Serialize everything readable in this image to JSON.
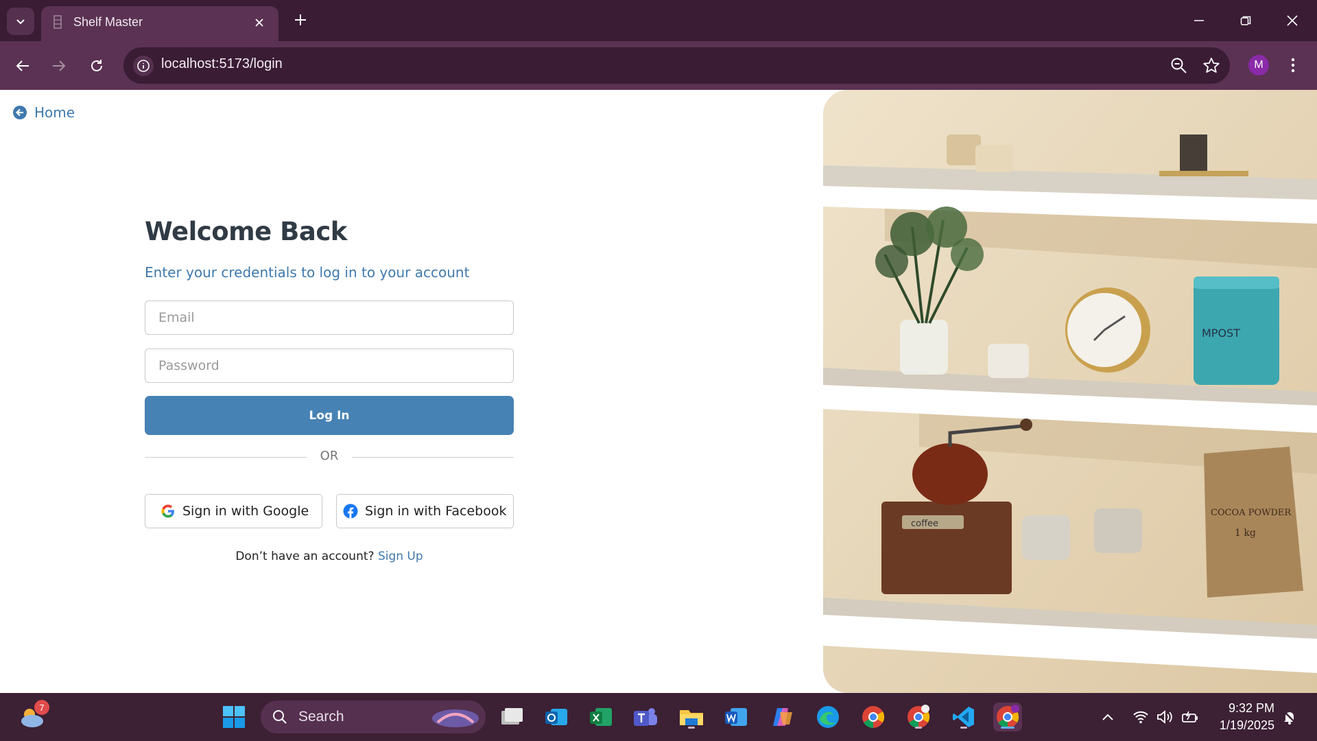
{
  "browser": {
    "tab_title": "Shelf Master",
    "url": "localhost:5173/login",
    "profile_initial": "M"
  },
  "page": {
    "home_label": "Home",
    "heading": "Welcome Back",
    "subheading": "Enter your credentials to log in to your account",
    "email_placeholder": "Email",
    "password_placeholder": "Password",
    "login_label": "Log In",
    "divider_label": "OR",
    "google_label": "Sign in with Google",
    "facebook_label": "Sign in with Facebook",
    "signup_prompt": "Don’t have an account?",
    "signup_link": "Sign Up",
    "hero_image": "shelf-decor-photo"
  },
  "taskbar": {
    "search_label": "Search",
    "weather_badge": "7",
    "time": "9:32 PM",
    "date": "1/19/2025",
    "apps": [
      "start",
      "file-manager",
      "outlook",
      "excel",
      "teams",
      "file-explorer",
      "word",
      "copilot",
      "edge",
      "chrome",
      "chrome-profile",
      "vscode",
      "chrome-active"
    ]
  },
  "colors": {
    "primary": "#4682b4",
    "link": "#3f79ad",
    "heading": "#303b45",
    "chrome_dark": "#3a1c35",
    "chrome_mid": "#5b3253"
  }
}
